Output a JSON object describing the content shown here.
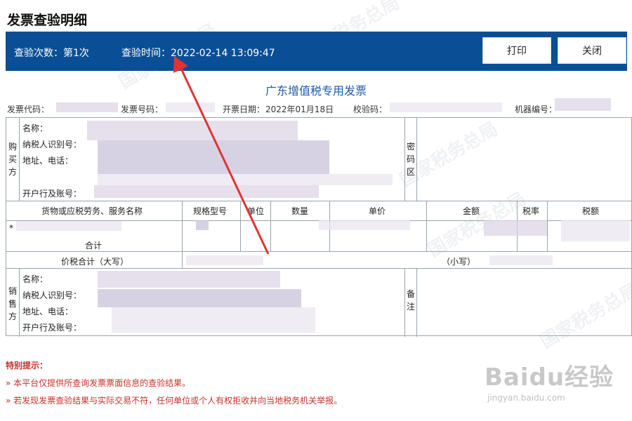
{
  "page_title": "发票查验明细",
  "header": {
    "check_count": "查验次数：第1次",
    "check_time": "查验时间：2022-02-14 13:09:47",
    "print_label": "打印",
    "close_label": "关闭",
    "bar_color": "#0a4f95"
  },
  "invoice_title": "广东增值税专用发票",
  "meta": {
    "code_label": "发票代码：",
    "number_label": "发票号码：",
    "date_label": "开票日期：",
    "date_value": "2022年01月18日",
    "check_code_label": "校验码：",
    "machine_label": "机器编号："
  },
  "buyer": {
    "side_label": "购买方",
    "name_label": "名称：",
    "tax_id_label": "纳税人识别号：",
    "address_label": "地址、电话：",
    "bank_label": "开户行及账号：",
    "password_label": "密码区"
  },
  "items": {
    "columns": [
      "货物或应税劳务、服务名称",
      "规格型号",
      "单位",
      "数量",
      "单价",
      "金额",
      "税率",
      "税额"
    ],
    "row_prefix": "*",
    "subtotal_label": "合计",
    "total_label": "价税合计（大写）",
    "total_small_label": "（小写）"
  },
  "seller": {
    "side_label": "销售方",
    "name_label": "名称：",
    "tax_id_label": "纳税人识别号：",
    "address_label": "地址、电话：",
    "bank_label": "开户行及账号：",
    "remark_label": "备注"
  },
  "notice": {
    "heading": "特别提示：",
    "lines": [
      "本平台仅提供所查询发票票面信息的查验结果。",
      "若发现发票查验结果与实际交易不符，任何单位或个人有权拒收并向当地税务机关举报。"
    ],
    "color": "#c9302c"
  },
  "watermark": {
    "text": "国家税务总局",
    "brand": "Baidu经验",
    "url": "jingyan.baidu.com"
  },
  "annotation_color": "#e03434"
}
